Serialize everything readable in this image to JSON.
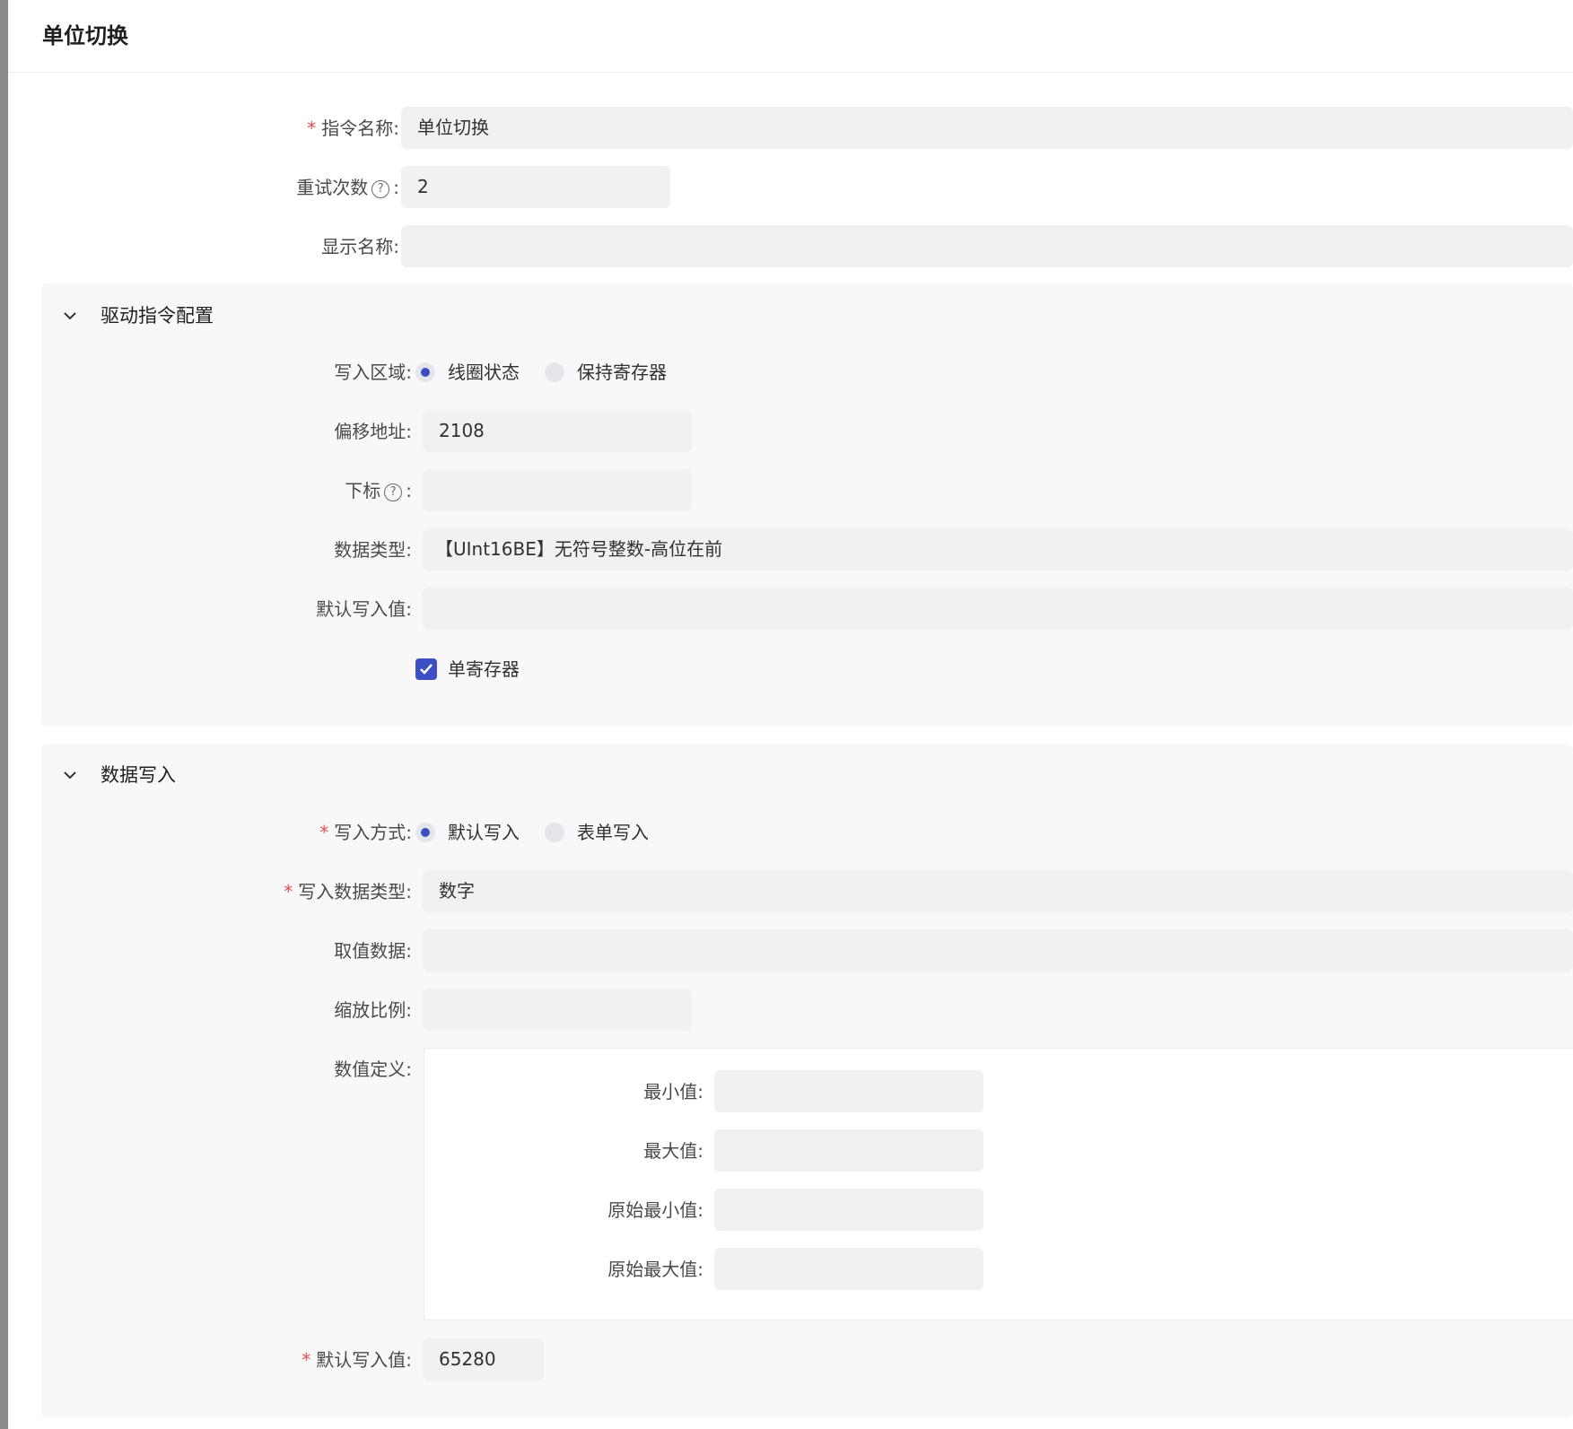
{
  "dialog": {
    "title": "单位切换"
  },
  "basic": {
    "instruction_name_label": "指令名称:",
    "instruction_name_value": "单位切换",
    "retry_label": "重试次数",
    "retry_colon": ":",
    "retry_value": "2",
    "display_name_label": "显示名称:",
    "display_name_value": ""
  },
  "driver_panel": {
    "title": "驱动指令配置",
    "write_area_label": "写入区域:",
    "write_area_options": [
      "线圈状态",
      "保持寄存器"
    ],
    "write_area_selected": "线圈状态",
    "offset_label": "偏移地址:",
    "offset_value": "2108",
    "index_label": "下标",
    "index_colon": ":",
    "index_value": "",
    "data_type_label": "数据类型:",
    "data_type_value": "【UInt16BE】无符号整数-高位在前",
    "default_write_label": "默认写入值:",
    "default_write_value": "",
    "single_register_label": "单寄存器",
    "single_register_checked": true
  },
  "data_panel": {
    "title": "数据写入",
    "write_mode_label": "写入方式:",
    "write_mode_options": [
      "默认写入",
      "表单写入"
    ],
    "write_mode_selected": "默认写入",
    "write_data_type_label": "写入数据类型:",
    "write_data_type_value": "数字",
    "value_data_label": "取值数据:",
    "value_data_value": "",
    "scale_label": "缩放比例:",
    "scale_value": "",
    "value_def_label": "数值定义:",
    "min_label": "最小值:",
    "max_label": "最大值:",
    "raw_min_label": "原始最小值:",
    "raw_max_label": "原始最大值:",
    "default_write_label": "默认写入值:",
    "default_write_value": "65280"
  },
  "colors": {
    "accent": "#3b4ec2",
    "required": "#e34d4d",
    "field_bg": "#f0f1f3",
    "panel_bg": "#f8f8f8"
  }
}
